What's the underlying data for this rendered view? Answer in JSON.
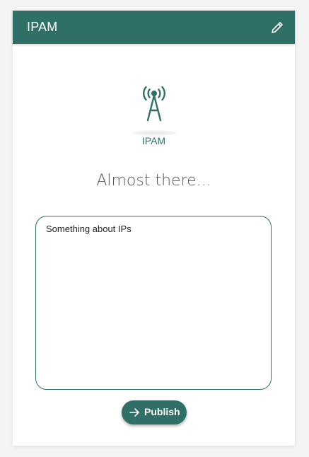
{
  "header": {
    "title": "IPAM",
    "edit_icon": "pencil-icon"
  },
  "logo": {
    "icon": "antenna-tower-icon",
    "label": "IPAM"
  },
  "status_text": "Almost there...",
  "description": {
    "value": "Something about IPs"
  },
  "publish": {
    "label": "Publish",
    "icon": "arrow-right-icon"
  },
  "colors": {
    "primary": "#2f6f66",
    "background": "#f4f4f4",
    "card": "#ffffff"
  }
}
